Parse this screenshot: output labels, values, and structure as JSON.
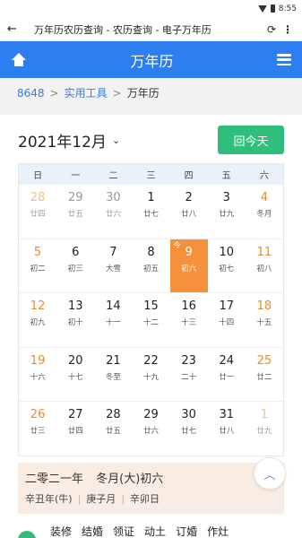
{
  "status": {
    "time": "8:55"
  },
  "appbar": {
    "title": "万年历农历查询 - 农历查询 - 电子万年历"
  },
  "header": {
    "title": "万年历"
  },
  "breadcrumb": [
    "8648",
    "实用工具",
    "万年历"
  ],
  "calendar": {
    "month_label": "2021年12月",
    "today_button": "回今天",
    "today_marker": "今",
    "weekdays": [
      "日",
      "一",
      "二",
      "三",
      "四",
      "五",
      "六"
    ],
    "days": [
      {
        "d": "28",
        "l": "廿四",
        "other": true
      },
      {
        "d": "29",
        "l": "廿五",
        "other": true
      },
      {
        "d": "30",
        "l": "廿六",
        "other": true
      },
      {
        "d": "1",
        "l": "廿七"
      },
      {
        "d": "2",
        "l": "廿八"
      },
      {
        "d": "3",
        "l": "廿九"
      },
      {
        "d": "4",
        "l": "冬月"
      },
      {
        "d": "5",
        "l": "初二"
      },
      {
        "d": "6",
        "l": "初三"
      },
      {
        "d": "7",
        "l": "大雪"
      },
      {
        "d": "8",
        "l": "初五"
      },
      {
        "d": "9",
        "l": "初六",
        "today": true
      },
      {
        "d": "10",
        "l": "初七"
      },
      {
        "d": "11",
        "l": "初八"
      },
      {
        "d": "12",
        "l": "初九"
      },
      {
        "d": "13",
        "l": "初十"
      },
      {
        "d": "14",
        "l": "十一"
      },
      {
        "d": "15",
        "l": "十二"
      },
      {
        "d": "16",
        "l": "十三"
      },
      {
        "d": "17",
        "l": "十四"
      },
      {
        "d": "18",
        "l": "十五"
      },
      {
        "d": "19",
        "l": "十六"
      },
      {
        "d": "20",
        "l": "十七"
      },
      {
        "d": "21",
        "l": "冬至"
      },
      {
        "d": "22",
        "l": "十九"
      },
      {
        "d": "23",
        "l": "二十"
      },
      {
        "d": "24",
        "l": "廿一"
      },
      {
        "d": "25",
        "l": "廿二"
      },
      {
        "d": "26",
        "l": "廿三"
      },
      {
        "d": "27",
        "l": "廿四"
      },
      {
        "d": "28",
        "l": "廿五"
      },
      {
        "d": "29",
        "l": "廿六"
      },
      {
        "d": "30",
        "l": "廿七"
      },
      {
        "d": "31",
        "l": "廿八"
      },
      {
        "d": "1",
        "l": "廿九",
        "other": true
      }
    ]
  },
  "info": {
    "year": "二零二一年",
    "month_day": "冬月(大)初六",
    "year_gz": "辛丑年(牛)",
    "month_gz": "庚子月",
    "day_gz": "辛卯日"
  },
  "yi_items": [
    "装修",
    "结婚",
    "领证",
    "动土",
    "订婚",
    "作灶"
  ]
}
